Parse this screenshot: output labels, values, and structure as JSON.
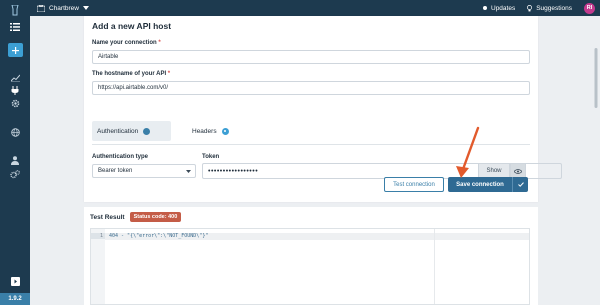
{
  "app": {
    "team_name": "Chartbrew",
    "version": "1.9.2",
    "updates_label": "Updates",
    "suggestions_label": "Suggestions",
    "avatar_initials": "RI"
  },
  "colors": {
    "sidebar_bg": "#1d3a4f",
    "accent": "#3c9fd4",
    "primary_button": "#2f6a93",
    "badge_error": "#c45c47",
    "arrow": "#e25a2c"
  },
  "form": {
    "title": "Add a new API host",
    "name_label": "Name your connection",
    "name_value": "Airtable",
    "host_label": "The hostname of your API",
    "host_value": "https://api.airtable.com/v0/",
    "required_mark": "*",
    "tabs": {
      "authentication": "Authentication",
      "headers": "Headers"
    },
    "auth_type_label": "Authentication type",
    "auth_type_value": "Bearer token",
    "token_label": "Token",
    "token_value": "•••••••••••••••••",
    "show_label": "Show",
    "test_label": "Test connection",
    "save_label": "Save connection"
  },
  "result": {
    "label": "Test Result",
    "status_badge": "Status code: 400",
    "line_number": "1",
    "code": "404 - \"{\\\"error\\\":\\\"NOT_FOUND\\\"}\""
  }
}
